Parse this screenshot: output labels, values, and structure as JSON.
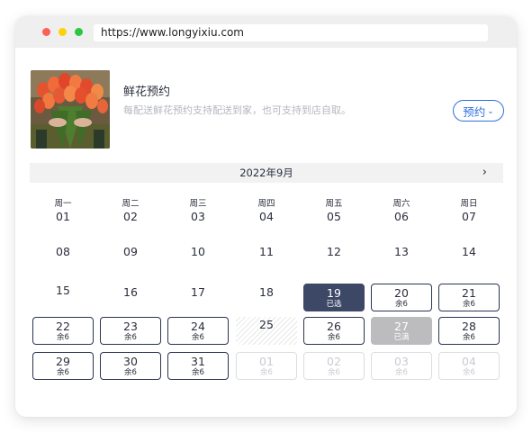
{
  "browser": {
    "url": "https://www.longyixiu.com"
  },
  "product": {
    "image_icon": "tulip-bouquet-photo",
    "title": "鲜花预约",
    "description": "每配送鲜花预约支持配送到家，也可支持到店自取。",
    "reserve_label": "预约",
    "reserve_chevron": "⌄"
  },
  "calendar": {
    "month_label": "2022年9月",
    "next_icon": "›",
    "weekdays": [
      "周一",
      "周二",
      "周三",
      "周四",
      "周五",
      "周六",
      "周日"
    ],
    "days": [
      {
        "num": "01",
        "state": "plain",
        "sub": ""
      },
      {
        "num": "02",
        "state": "plain",
        "sub": ""
      },
      {
        "num": "03",
        "state": "plain",
        "sub": ""
      },
      {
        "num": "04",
        "state": "plain",
        "sub": ""
      },
      {
        "num": "05",
        "state": "plain",
        "sub": ""
      },
      {
        "num": "06",
        "state": "plain",
        "sub": ""
      },
      {
        "num": "07",
        "state": "plain",
        "sub": ""
      },
      {
        "num": "08",
        "state": "plain",
        "sub": ""
      },
      {
        "num": "09",
        "state": "plain",
        "sub": ""
      },
      {
        "num": "10",
        "state": "plain",
        "sub": ""
      },
      {
        "num": "11",
        "state": "plain",
        "sub": ""
      },
      {
        "num": "12",
        "state": "plain",
        "sub": ""
      },
      {
        "num": "13",
        "state": "plain",
        "sub": ""
      },
      {
        "num": "14",
        "state": "plain",
        "sub": ""
      },
      {
        "num": "15",
        "state": "plain",
        "sub": ""
      },
      {
        "num": "16",
        "state": "plain",
        "sub": ""
      },
      {
        "num": "17",
        "state": "plain",
        "sub": ""
      },
      {
        "num": "18",
        "state": "plain",
        "sub": ""
      },
      {
        "num": "19",
        "state": "selected",
        "sub": "已选"
      },
      {
        "num": "20",
        "state": "avail",
        "sub": "余6"
      },
      {
        "num": "21",
        "state": "avail",
        "sub": "余6"
      },
      {
        "num": "22",
        "state": "avail",
        "sub": "余6"
      },
      {
        "num": "23",
        "state": "avail",
        "sub": "余6"
      },
      {
        "num": "24",
        "state": "avail",
        "sub": "余6"
      },
      {
        "num": "25",
        "state": "hatched",
        "sub": ""
      },
      {
        "num": "26",
        "state": "avail",
        "sub": "余6"
      },
      {
        "num": "27",
        "state": "full",
        "sub": "已满"
      },
      {
        "num": "28",
        "state": "avail",
        "sub": "余6"
      },
      {
        "num": "29",
        "state": "avail",
        "sub": "余6"
      },
      {
        "num": "30",
        "state": "avail",
        "sub": "余6"
      },
      {
        "num": "31",
        "state": "avail",
        "sub": "余6"
      },
      {
        "num": "01",
        "state": "next",
        "sub": "余6"
      },
      {
        "num": "02",
        "state": "next",
        "sub": "余6"
      },
      {
        "num": "03",
        "state": "next",
        "sub": "余6"
      },
      {
        "num": "04",
        "state": "next",
        "sub": "余6"
      }
    ]
  },
  "colors": {
    "accent": "#2f6fde",
    "selected": "#3d4766",
    "full": "#bcbcbf",
    "available_border": "#2c3452"
  }
}
